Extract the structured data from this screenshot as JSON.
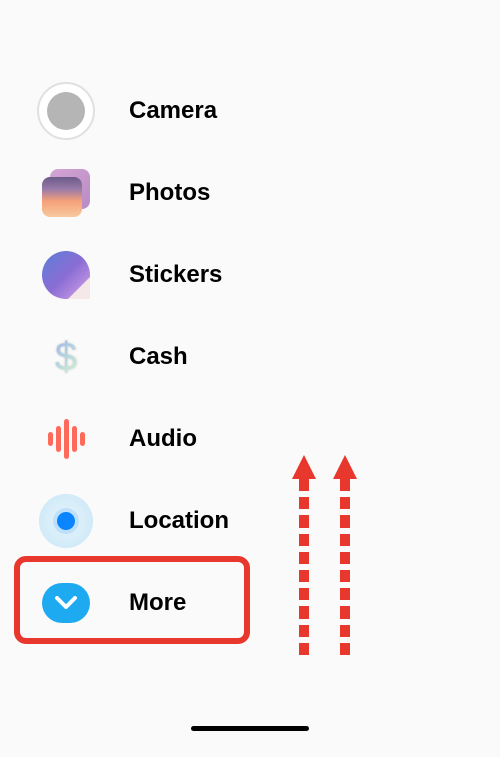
{
  "menu": {
    "items": [
      {
        "id": "camera",
        "label": "Camera"
      },
      {
        "id": "photos",
        "label": "Photos"
      },
      {
        "id": "stickers",
        "label": "Stickers"
      },
      {
        "id": "cash",
        "label": "Cash"
      },
      {
        "id": "audio",
        "label": "Audio"
      },
      {
        "id": "location",
        "label": "Location"
      },
      {
        "id": "more",
        "label": "More"
      }
    ]
  },
  "annotations": {
    "highlight_target": "more",
    "highlight_color": "#e8372d",
    "arrow_direction": "up",
    "arrow_count": 2
  }
}
